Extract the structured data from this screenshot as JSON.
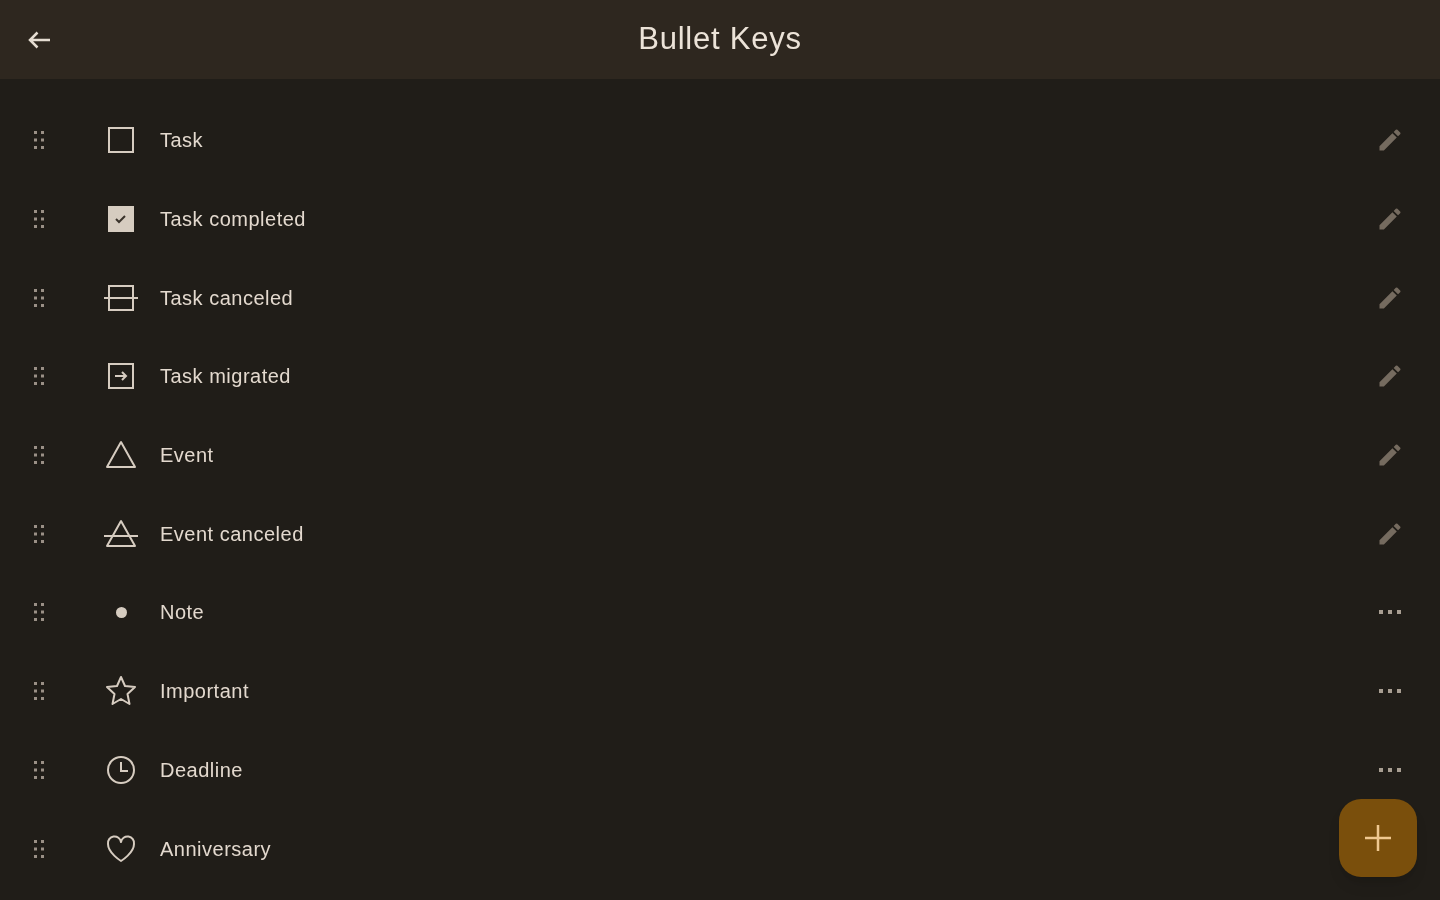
{
  "header": {
    "title": "Bullet Keys"
  },
  "keys": [
    {
      "kind": "task",
      "label": "Task",
      "action": {
        "kind": "edit"
      }
    },
    {
      "kind": "task_completed",
      "label": "Task completed",
      "action": {
        "kind": "edit"
      }
    },
    {
      "kind": "task_canceled",
      "label": "Task canceled",
      "action": {
        "kind": "edit"
      }
    },
    {
      "kind": "task_migrated",
      "label": "Task migrated",
      "action": {
        "kind": "edit"
      }
    },
    {
      "kind": "event",
      "label": "Event",
      "action": {
        "kind": "edit"
      }
    },
    {
      "kind": "event_canceled",
      "label": "Event canceled",
      "action": {
        "kind": "edit"
      }
    },
    {
      "kind": "note",
      "label": "Note",
      "action": {
        "kind": "more"
      }
    },
    {
      "kind": "important",
      "label": "Important",
      "action": {
        "kind": "more"
      }
    },
    {
      "kind": "deadline",
      "label": "Deadline",
      "action": {
        "kind": "more"
      }
    },
    {
      "kind": "anniversary",
      "label": "Anniversary"
    }
  ]
}
